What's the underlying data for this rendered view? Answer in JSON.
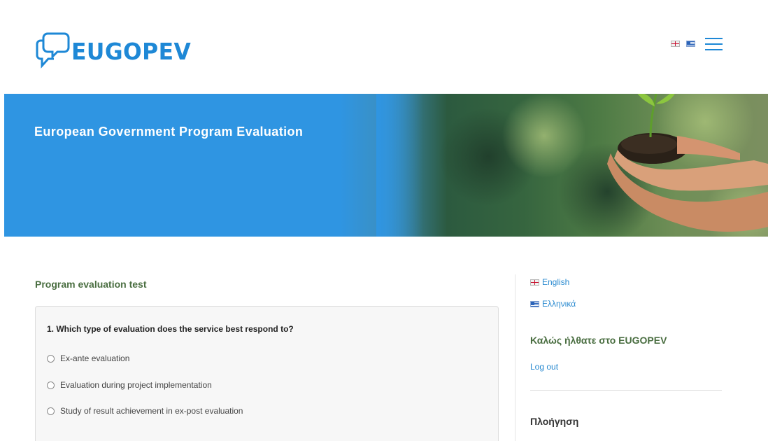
{
  "header": {
    "logo_text": "EUGOPEV",
    "brand_color": "#1e88d6",
    "language_flags": [
      "english-flag-icon",
      "greek-flag-icon"
    ],
    "menu_icon": "hamburger-menu-icon"
  },
  "hero": {
    "title": "European Government Program Evaluation",
    "background_color": "#2f95e2"
  },
  "main": {
    "section_title": "Program evaluation test",
    "question": {
      "text": "1. Which type of evaluation does the service best respond to?",
      "options": [
        "Ex-ante evaluation",
        "Evaluation during project implementation",
        "Study of result achievement in ex-post evaluation"
      ]
    }
  },
  "sidebar": {
    "languages": [
      {
        "label": "English",
        "icon": "english-flag-icon"
      },
      {
        "label": "Ελληνικά",
        "icon": "greek-flag-icon"
      }
    ],
    "welcome": "Καλώς ήλθατε στο EUGOPEV",
    "logout": "Log out",
    "navigation_title": "Πλοήγηση",
    "link_color": "#2a8ad0",
    "heading_color": "#4a6e41"
  }
}
